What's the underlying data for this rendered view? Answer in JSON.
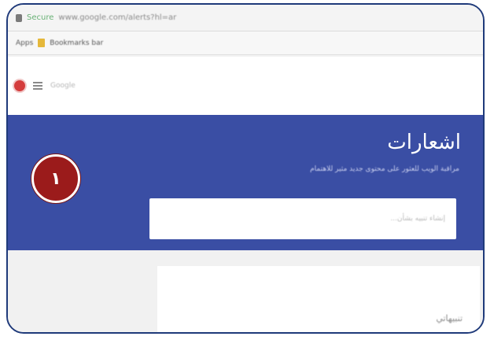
{
  "browser": {
    "secure_text": "Secure",
    "url_text": "www.google.com/alerts?hl=ar"
  },
  "bookmarks": {
    "apps_label": "Apps",
    "folder_label": "Bookmarks bar"
  },
  "toolbar": {
    "label": "Google"
  },
  "alerts": {
    "title": "اشعارات",
    "subtitle": "مراقبة الويب للعثور على محتوى جديد مثير للاهتمام",
    "search_placeholder": "إنشاء تنبيه بشأن..."
  },
  "marker": {
    "number": "١"
  },
  "content": {
    "label": "تنبيهاتي"
  },
  "colors": {
    "banner": "#3a4ea4",
    "marker": "#9b1b1b",
    "frame": "#1f3a7a"
  }
}
